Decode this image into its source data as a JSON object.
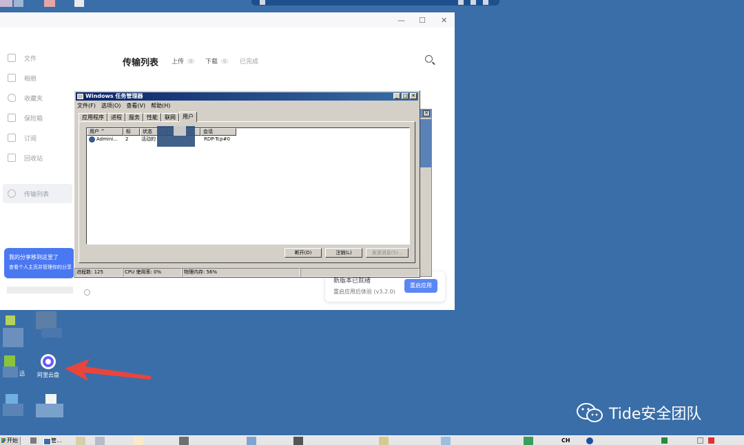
{
  "aliyun": {
    "window_controls": {
      "minimize": "—",
      "maximize": "☐",
      "close": "✕"
    },
    "sidebar": [
      {
        "label": "文件",
        "icon": "file-icon"
      },
      {
        "label": "相册",
        "icon": "photo-icon"
      },
      {
        "label": "收藏夹",
        "icon": "heart-icon"
      },
      {
        "label": "保险箱",
        "icon": "safe-icon"
      },
      {
        "label": "订阅",
        "icon": "bookmark-icon"
      },
      {
        "label": "回收站",
        "icon": "trash-icon"
      },
      {
        "label": "传输列表",
        "icon": "transfer-icon"
      }
    ],
    "page_title": "传输列表",
    "tabs": {
      "upload": {
        "label": "上传",
        "count": "0"
      },
      "download": {
        "label": "下载",
        "count": "0"
      },
      "done": {
        "label": "已完成"
      }
    },
    "share_tip": {
      "line1": "我的分享移到这里了",
      "line2": "查看个人主页并管理你的分享"
    },
    "update": {
      "title": "新版本已就绪",
      "desc": "重启应用后体验 (v3.2.0)",
      "button": "重启应用"
    }
  },
  "taskmgr": {
    "title": "Windows 任务管理器",
    "menu": [
      "文件(F)",
      "选项(O)",
      "查看(V)",
      "帮助(H)"
    ],
    "tabs": [
      "应用程序",
      "进程",
      "服务",
      "性能",
      "联网",
      "用户"
    ],
    "active_tab": "用户",
    "columns": [
      "用户 ^",
      "标",
      "状态",
      "",
      "会话"
    ],
    "rows": [
      {
        "user": "Admini...",
        "id": "2",
        "status": "活动的",
        "session": "RDP-Tcp#0"
      }
    ],
    "buttons": {
      "disconnect": "断开(D)",
      "logoff": "注销(L)",
      "send_message": "发送消息(S)..."
    },
    "status": {
      "processes": "进程数: 125",
      "cpu": "CPU 使用率: 0%",
      "memory": "物理内存: 56%"
    }
  },
  "desktop": {
    "aliyun_icon_label": "阿里云盘",
    "frag_label": "迅"
  },
  "watermark": "Tide安全团队",
  "taskbar": {
    "start": "开始",
    "task": "管...",
    "tray": "CH"
  },
  "colors": {
    "desktop": "#3a6ea8",
    "accent": "#5b86f5",
    "arrow": "#e8453c"
  }
}
